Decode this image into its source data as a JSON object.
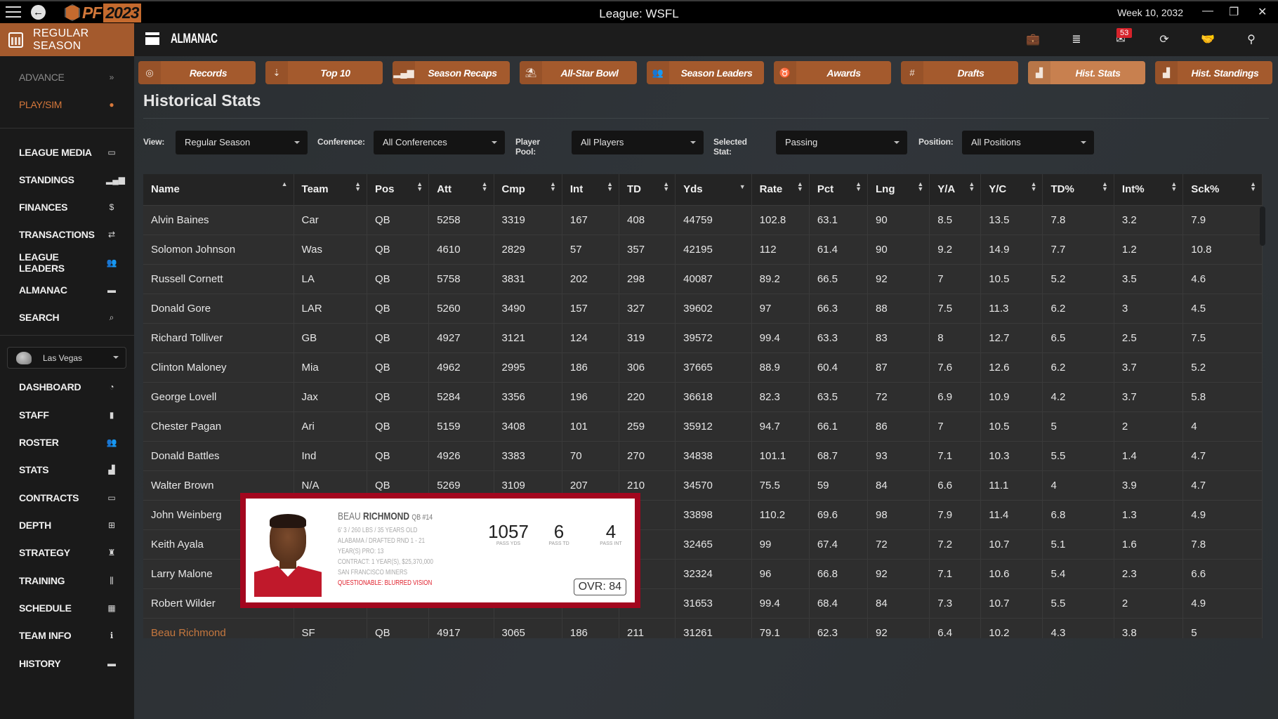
{
  "titlebar": {
    "app_logo": "PF",
    "app_logo_year": "2023",
    "league": "League: WSFL",
    "week": "Week 10, 2032",
    "minimize": "—",
    "restore": "❐",
    "close": "✕"
  },
  "header": {
    "season_label": "REGULAR SEASON",
    "section_title": "ALMANAC",
    "inbox_count": "53",
    "icons": [
      "briefcase-icon",
      "database-icon",
      "mail-icon",
      "refresh-icon",
      "handshake-icon",
      "binoculars-icon"
    ]
  },
  "sidebar": {
    "top_items": [
      {
        "label": "ADVANCE",
        "icon": "»"
      },
      {
        "label": "PLAY/SIM",
        "icon": "🏈"
      }
    ],
    "league_items": [
      {
        "label": "LEAGUE MEDIA",
        "icon": "▭"
      },
      {
        "label": "STANDINGS",
        "icon": "▂▄▆"
      },
      {
        "label": "FINANCES",
        "icon": "$"
      },
      {
        "label": "TRANSACTIONS",
        "icon": "⇄"
      },
      {
        "label": "LEAGUE LEADERS",
        "icon": "👥"
      },
      {
        "label": "ALMANAC",
        "icon": "▬"
      },
      {
        "label": "SEARCH",
        "icon": "🔍"
      }
    ],
    "team_select": "Las Vegas",
    "team_items": [
      {
        "label": "DASHBOARD",
        "icon": "◔"
      },
      {
        "label": "STAFF",
        "icon": "▮"
      },
      {
        "label": "ROSTER",
        "icon": "👥"
      },
      {
        "label": "STATS",
        "icon": "📊"
      },
      {
        "label": "CONTRACTS",
        "icon": "▭"
      },
      {
        "label": "DEPTH",
        "icon": "⊞"
      },
      {
        "label": "STRATEGY",
        "icon": "♜"
      },
      {
        "label": "TRAINING",
        "icon": "⫼"
      },
      {
        "label": "SCHEDULE",
        "icon": "▦"
      },
      {
        "label": "TEAM INFO",
        "icon": "ℹ"
      },
      {
        "label": "HISTORY",
        "icon": "▬"
      }
    ]
  },
  "tabs": [
    {
      "label": "Records",
      "icon": "◎"
    },
    {
      "label": "Top 10",
      "icon": "⇣"
    },
    {
      "label": "Season Recaps",
      "icon": "▂▄▆"
    },
    {
      "label": "All-Star Bowl",
      "icon": "⛱"
    },
    {
      "label": "Season Leaders",
      "icon": "👥"
    },
    {
      "label": "Awards",
      "icon": "♉"
    },
    {
      "label": "Drafts",
      "icon": "#"
    },
    {
      "label": "Hist. Stats",
      "icon": "📊",
      "active": true
    },
    {
      "label": "Hist. Standings",
      "icon": "📊"
    }
  ],
  "page_title": "Historical Stats",
  "filters": {
    "view_label": "View:",
    "view_value": "Regular Season",
    "conference_label": "Conference:",
    "conference_value": "All Conferences",
    "pool_label": "Player Pool:",
    "pool_value": "All Players",
    "stat_label": "Selected Stat:",
    "stat_value": "Passing",
    "position_label": "Position:",
    "position_value": "All Positions"
  },
  "table": {
    "columns": [
      "Name",
      "Team",
      "Pos",
      "Att",
      "Cmp",
      "Int",
      "TD",
      "Yds",
      "Rate",
      "Pct",
      "Lng",
      "Y/A",
      "Y/C",
      "TD%",
      "Int%",
      "Sck%"
    ],
    "sort": {
      "Name": "asc",
      "Yds": "desc"
    },
    "rows": [
      [
        "Alvin Baines",
        "Car",
        "QB",
        "5258",
        "3319",
        "167",
        "408",
        "44759",
        "102.8",
        "63.1",
        "90",
        "8.5",
        "13.5",
        "7.8",
        "3.2",
        "7.9"
      ],
      [
        "Solomon Johnson",
        "Was",
        "QB",
        "4610",
        "2829",
        "57",
        "357",
        "42195",
        "112",
        "61.4",
        "90",
        "9.2",
        "14.9",
        "7.7",
        "1.2",
        "10.8"
      ],
      [
        "Russell Cornett",
        "LA",
        "QB",
        "5758",
        "3831",
        "202",
        "298",
        "40087",
        "89.2",
        "66.5",
        "92",
        "7",
        "10.5",
        "5.2",
        "3.5",
        "4.6"
      ],
      [
        "Donald Gore",
        "LAR",
        "QB",
        "5260",
        "3490",
        "157",
        "327",
        "39602",
        "97",
        "66.3",
        "88",
        "7.5",
        "11.3",
        "6.2",
        "3",
        "4.5"
      ],
      [
        "Richard Tolliver",
        "GB",
        "QB",
        "4927",
        "3121",
        "124",
        "319",
        "39572",
        "99.4",
        "63.3",
        "83",
        "8",
        "12.7",
        "6.5",
        "2.5",
        "7.5"
      ],
      [
        "Clinton Maloney",
        "Mia",
        "QB",
        "4962",
        "2995",
        "186",
        "306",
        "37665",
        "88.9",
        "60.4",
        "87",
        "7.6",
        "12.6",
        "6.2",
        "3.7",
        "5.2"
      ],
      [
        "George Lovell",
        "Jax",
        "QB",
        "5284",
        "3356",
        "196",
        "220",
        "36618",
        "82.3",
        "63.5",
        "72",
        "6.9",
        "10.9",
        "4.2",
        "3.7",
        "5.8"
      ],
      [
        "Chester Pagan",
        "Ari",
        "QB",
        "5159",
        "3408",
        "101",
        "259",
        "35912",
        "94.7",
        "66.1",
        "86",
        "7",
        "10.5",
        "5",
        "2",
        "4"
      ],
      [
        "Donald Battles",
        "Ind",
        "QB",
        "4926",
        "3383",
        "70",
        "270",
        "34838",
        "101.1",
        "68.7",
        "93",
        "7.1",
        "10.3",
        "5.5",
        "1.4",
        "4.7"
      ],
      [
        "Walter Brown",
        "N/A",
        "QB",
        "5269",
        "3109",
        "207",
        "210",
        "34570",
        "75.5",
        "59",
        "84",
        "6.6",
        "11.1",
        "4",
        "3.9",
        "4.7"
      ],
      [
        "John Weinberg",
        "",
        "",
        "",
        "",
        "",
        "",
        "33898",
        "110.2",
        "69.6",
        "98",
        "7.9",
        "11.4",
        "6.8",
        "1.3",
        "4.9"
      ],
      [
        "Keith Ayala",
        "",
        "",
        "",
        "",
        "",
        "",
        "32465",
        "99",
        "67.4",
        "72",
        "7.2",
        "10.7",
        "5.1",
        "1.6",
        "7.8"
      ],
      [
        "Larry Malone",
        "",
        "",
        "",
        "",
        "",
        "",
        "32324",
        "96",
        "66.8",
        "92",
        "7.1",
        "10.6",
        "5.4",
        "2.3",
        "6.6"
      ],
      [
        "Robert Wilder",
        "",
        "",
        "",
        "",
        "",
        "",
        "31653",
        "99.4",
        "68.4",
        "84",
        "7.3",
        "10.7",
        "5.5",
        "2",
        "4.9"
      ],
      [
        "Beau Richmond",
        "SF",
        "QB",
        "4917",
        "3065",
        "186",
        "211",
        "31261",
        "79.1",
        "62.3",
        "92",
        "6.4",
        "10.2",
        "4.3",
        "3.8",
        "5"
      ]
    ],
    "highlight_row": 14
  },
  "player_card": {
    "first_name": "BEAU",
    "last_name": "RICHMOND",
    "pos_num": "QB #14",
    "line1": "6' 3 / 260 LBS / 35 YEARS OLD",
    "line2": "ALABAMA / DRAFTED RND 1 - 21",
    "line3": "YEAR(S) PRO: 13",
    "line4": "CONTRACT: 1 YEAR(S), $25,370,000",
    "line5": "SAN FRANCISCO MINERS",
    "injury": "QUESTIONABLE: BLURRED VISION",
    "stats": [
      {
        "value": "1057",
        "label": "PASS YDS"
      },
      {
        "value": "6",
        "label": "PASS TD"
      },
      {
        "value": "4",
        "label": "PASS INT"
      }
    ],
    "ovr": "OVR: 84"
  },
  "colors": {
    "accent": "#a45a2d",
    "accent_active": "#c8804f",
    "highlight_name": "#c4773f",
    "card_border": "#a3061e",
    "badge": "#d6232b"
  }
}
